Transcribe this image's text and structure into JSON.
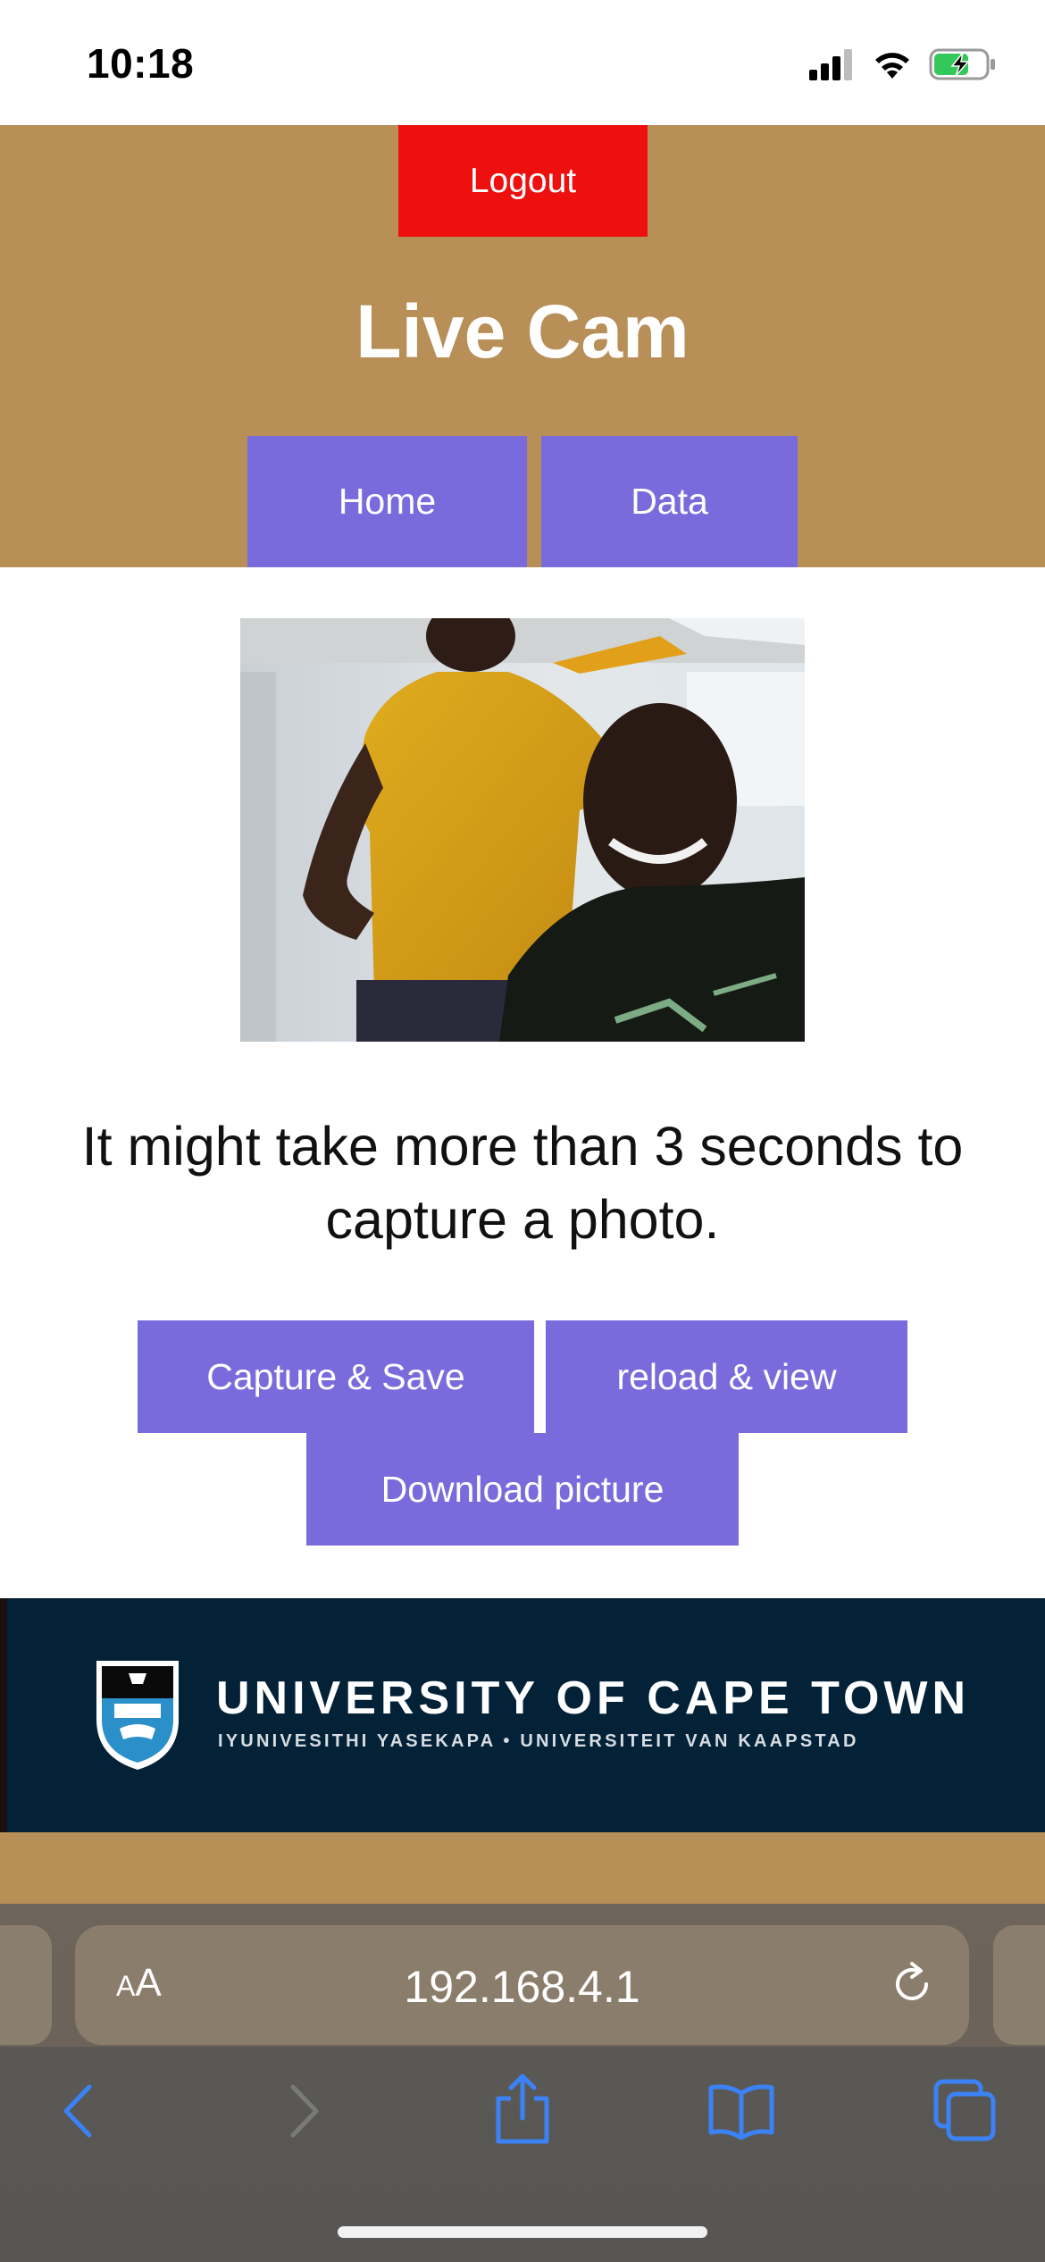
{
  "status_bar": {
    "time": "10:18",
    "icons": [
      "signal-icon",
      "wifi-icon",
      "battery-charging-icon"
    ]
  },
  "header": {
    "logout_label": "Logout",
    "title": "Live Cam",
    "nav": {
      "home_label": "Home",
      "data_label": "Data"
    },
    "colors": {
      "background": "#b78f57",
      "logout": "#ee0f0f",
      "nav": "#7a6bdc"
    }
  },
  "camera": {
    "image": "live-camera-photo"
  },
  "notice": "It might take more than 3 seconds to capture a photo.",
  "actions": {
    "capture_label": "Capture & Save",
    "reload_label": "reload & view",
    "download_label": "Download picture"
  },
  "banner": {
    "title": "UNIVERSITY OF CAPE TOWN",
    "subtitle": "IYUNIVESITHI YASEKAPA • UNIVERSITEIT VAN KAAPSTAD",
    "color": "#032238"
  },
  "browser": {
    "text_size_label": "AA",
    "url": "192.168.4.1",
    "toolbar_icons": [
      "back-icon",
      "forward-icon",
      "share-icon",
      "bookmarks-icon",
      "tabs-icon"
    ],
    "accent": "#3b82f6"
  }
}
